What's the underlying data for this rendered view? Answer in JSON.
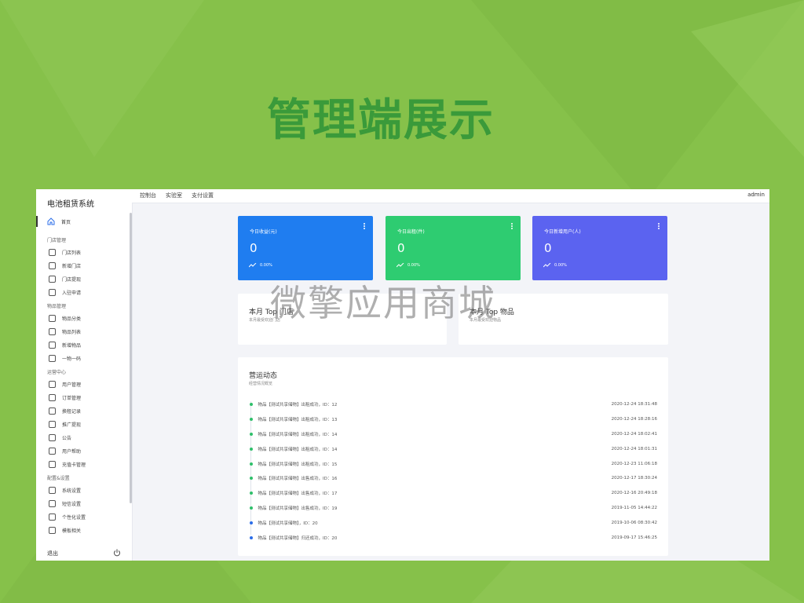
{
  "slide": {
    "title": "管理端展示"
  },
  "watermark": "微擎应用商城",
  "app": {
    "brand": "电池租赁系统",
    "top_nav": [
      "控制台",
      "实验室",
      "支付设置"
    ],
    "user": "admin",
    "sidebar": {
      "home": {
        "label": "首页",
        "icon": "home-icon"
      },
      "sections": [
        {
          "title": "门店管理",
          "items": [
            {
              "label": "门店列表",
              "icon": "store-icon"
            },
            {
              "label": "新增门店",
              "icon": "add-store-icon"
            },
            {
              "label": "门店提现",
              "icon": "yen-icon"
            },
            {
              "label": "入驻申请",
              "icon": "document-icon"
            }
          ]
        },
        {
          "title": "物品管理",
          "items": [
            {
              "label": "物品分类",
              "icon": "tag-icon"
            },
            {
              "label": "物品列表",
              "icon": "list-icon"
            },
            {
              "label": "新增物品",
              "icon": "add-box-icon"
            },
            {
              "label": "一物一码",
              "icon": "tablet-icon"
            }
          ]
        },
        {
          "title": "运营中心",
          "items": [
            {
              "label": "用户管理",
              "icon": "user-icon"
            },
            {
              "label": "订单管理",
              "icon": "order-icon"
            },
            {
              "label": "换租记录",
              "icon": "cube-icon"
            },
            {
              "label": "推广提现",
              "icon": "yen-icon"
            },
            {
              "label": "公告",
              "icon": "speaker-icon"
            },
            {
              "label": "用户帮助",
              "icon": "help-icon"
            },
            {
              "label": "充值卡管理",
              "icon": "card-icon"
            }
          ]
        },
        {
          "title": "配置&设置",
          "items": [
            {
              "label": "系统设置",
              "icon": "gear-icon"
            },
            {
              "label": "短信设置",
              "icon": "sms-icon"
            },
            {
              "label": "个性化设置",
              "icon": "layout-icon"
            },
            {
              "label": "模板相关",
              "icon": "cog-icon"
            }
          ]
        }
      ],
      "logout": "退出"
    },
    "stat_cards": [
      {
        "title": "今日收益(元)",
        "value": "0",
        "pct": "0.00%",
        "color": "#1f7df0"
      },
      {
        "title": "今日出租(件)",
        "value": "0",
        "pct": "0.00%",
        "color": "#2ecc71"
      },
      {
        "title": "今日新增用户(人)",
        "value": "0",
        "pct": "0.00%",
        "color": "#5b63f0"
      }
    ],
    "top_panels": [
      {
        "title": "本月 Top 门店",
        "subtitle": "本月最受欢迎门店"
      },
      {
        "title": "本月 Top 物品",
        "subtitle": "本月最受欢迎物品"
      }
    ],
    "activity": {
      "title": "营运动态",
      "subtitle": "经营情况概览",
      "rows": [
        {
          "text": "物品【测试共享储物】出租成功，ID：12",
          "time": "2020-12-24 18:31:48",
          "dot": "#2fbf6a"
        },
        {
          "text": "物品【测试共享储物】出租成功，ID：13",
          "time": "2020-12-24 18:28:16",
          "dot": "#2fbf6a"
        },
        {
          "text": "物品【测试共享储物】出租成功，ID：14",
          "time": "2020-12-24 18:02:41",
          "dot": "#2fbf6a"
        },
        {
          "text": "物品【测试共享储物】出租成功，ID：14",
          "time": "2020-12-24 18:01:31",
          "dot": "#2fbf6a"
        },
        {
          "text": "物品【测试共享储物】出租成功，ID：15",
          "time": "2020-12-23 11:06:18",
          "dot": "#2fbf6a"
        },
        {
          "text": "物品【测试共享储物】出售成功，ID：16",
          "time": "2020-12-17 18:30:24",
          "dot": "#2fbf6a"
        },
        {
          "text": "物品【测试共享储物】出售成功，ID：17",
          "time": "2020-12-16 20:49:18",
          "dot": "#2fbf6a"
        },
        {
          "text": "物品【测试共享储物】出售成功，ID：19",
          "time": "2019-11-05 14:44:22",
          "dot": "#2fbf6a"
        },
        {
          "text": "物品【测试共享储物】，ID：20",
          "time": "2019-10-06 08:30:42",
          "dot": "#2b6de8"
        },
        {
          "text": "物品【测试共享储物】归还成功，ID：20",
          "time": "2019-09-17 15:46:25",
          "dot": "#2b6de8"
        }
      ]
    }
  }
}
